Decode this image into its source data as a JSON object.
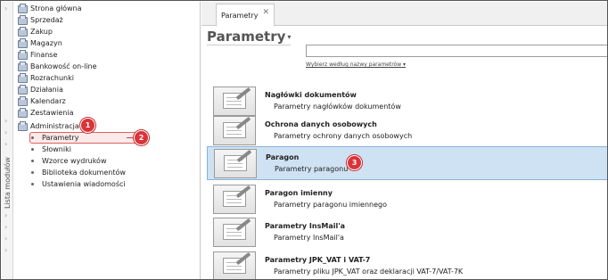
{
  "side_strip": {
    "label": "Lista modułów"
  },
  "nav": {
    "items": [
      {
        "label": "Strona główna",
        "icon": "home-icon"
      },
      {
        "label": "Sprzedaż",
        "icon": "sales-icon"
      },
      {
        "label": "Zakup",
        "icon": "purchase-icon"
      },
      {
        "label": "Magazyn",
        "icon": "warehouse-icon"
      },
      {
        "label": "Finanse",
        "icon": "finance-icon"
      },
      {
        "label": "Bankowość on-line",
        "icon": "bank-icon"
      },
      {
        "label": "Rozrachunki",
        "icon": "settlements-icon"
      },
      {
        "label": "Działania",
        "icon": "actions-icon"
      },
      {
        "label": "Kalendarz",
        "icon": "calendar-icon"
      },
      {
        "label": "Zestawienia",
        "icon": "reports-icon"
      },
      {
        "label": "Administracja",
        "icon": "admin-icon"
      }
    ],
    "sub_items": [
      {
        "label": "Parametry",
        "active": true
      },
      {
        "label": "Słowniki"
      },
      {
        "label": "Wzorce wydruków"
      },
      {
        "label": "Biblioteka dokumentów"
      },
      {
        "label": "Ustawienia wiadomości"
      }
    ]
  },
  "badges": [
    "1",
    "2",
    "3"
  ],
  "tab": {
    "label": "Parametry",
    "close": "✕"
  },
  "page": {
    "title": "Parametry",
    "caret": "▾",
    "search_value": "",
    "search_hint": "Wybierz według nazwy parametrów",
    "search_hint_caret": "▾"
  },
  "list": [
    {
      "title": "Nagłówki dokumentów",
      "desc": "Parametry nagłówków dokumentów"
    },
    {
      "title": "Ochrona danych osobowych",
      "desc": "Parametry ochrony danych osobowych"
    },
    {
      "title": "Paragon",
      "desc": "Parametry paragonu",
      "selected": true
    },
    {
      "title": "Paragon imienny",
      "desc": "Parametry paragonu imiennego"
    },
    {
      "title": "Parametry InsMail'a",
      "desc": "Parametry InsMail'a"
    },
    {
      "title": "Parametry JPK_VAT i VAT-7",
      "desc": "Parametry pliku JPK_VAT oraz deklaracji VAT-7/VAT-7K"
    }
  ],
  "colors": {
    "accent_red": "#d9343a",
    "selection_blue": "#cfe2f3"
  }
}
